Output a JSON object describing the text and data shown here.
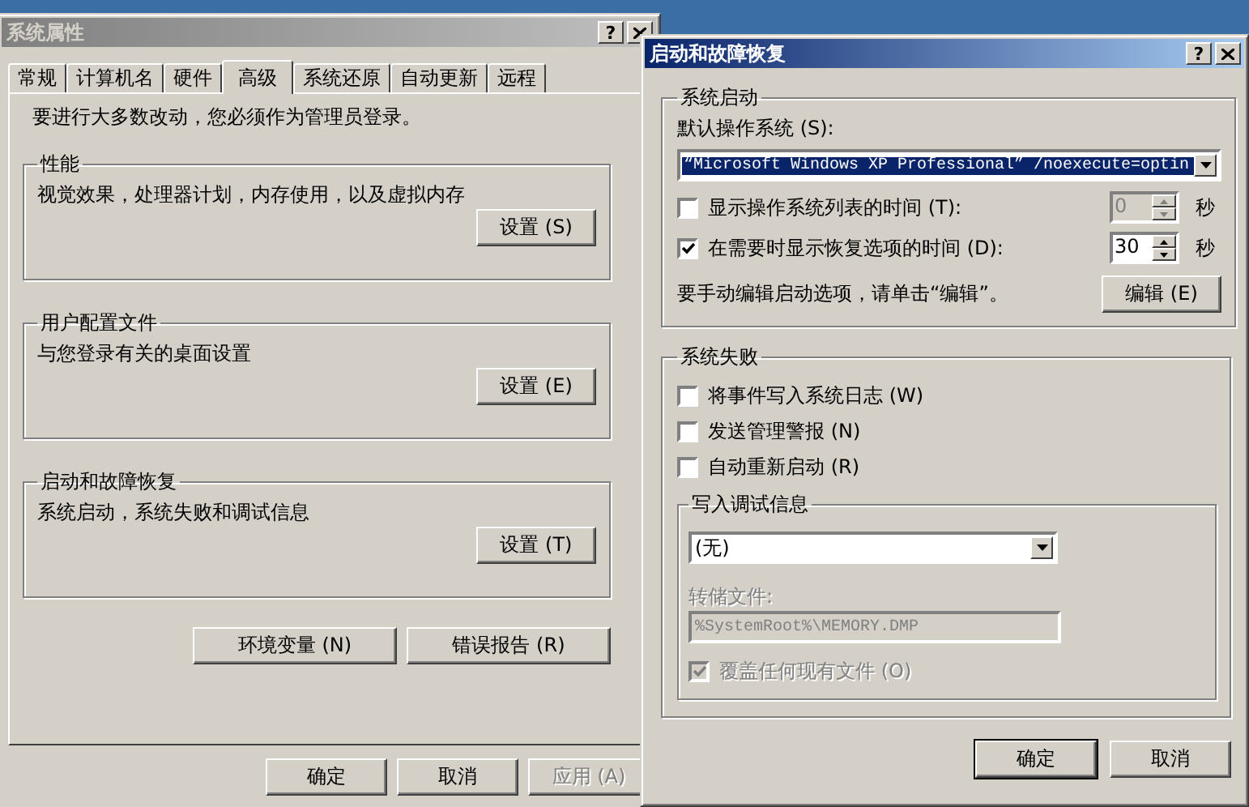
{
  "back_window": {
    "title": "系统属性",
    "help_button": "?",
    "tabs": [
      {
        "label": "常规",
        "selected": false
      },
      {
        "label": "计算机名",
        "selected": false
      },
      {
        "label": "硬件",
        "selected": false
      },
      {
        "label": "高级",
        "selected": true
      },
      {
        "label": "系统还原",
        "selected": false
      },
      {
        "label": "自动更新",
        "selected": false
      },
      {
        "label": "远程",
        "selected": false
      }
    ],
    "notice": "要进行大多数改动，您必须作为管理员登录。",
    "groups": [
      {
        "title": "性能",
        "description": "视觉效果，处理器计划，内存使用，以及虚拟内存",
        "button": "设置 (S)"
      },
      {
        "title": "用户配置文件",
        "description": "与您登录有关的桌面设置",
        "button": "设置 (E)"
      },
      {
        "title": "启动和故障恢复",
        "description": "系统启动，系统失败和调试信息",
        "button": "设置 (T)"
      }
    ],
    "extra_buttons": [
      "环境变量 (N)",
      "错误报告 (R)"
    ],
    "buttons": [
      {
        "label": "确定",
        "disabled": false
      },
      {
        "label": "取消",
        "disabled": false
      },
      {
        "label": "应用 (A)",
        "disabled": true
      }
    ]
  },
  "front_window": {
    "title": "启动和故障恢复",
    "help_button": "?",
    "startup": {
      "title": "系统启动",
      "default_os_label": "默认操作系统 (S):",
      "default_os": "“Microsoft Windows XP Professional” /noexecute=optin",
      "options": [
        {
          "label": "显示操作系统列表的时间 (T):",
          "checked": false,
          "seconds": "0",
          "unit": "秒"
        },
        {
          "label": "在需要时显示恢复选项的时间 (D):",
          "checked": true,
          "seconds": "30",
          "unit": "秒"
        }
      ],
      "edit_hint": "要手动编辑启动选项，请单击“编辑”。",
      "edit_button": "编辑 (E)"
    },
    "failure": {
      "title": "系统失败",
      "options": [
        {
          "label": "将事件写入系统日志 (W)",
          "checked": false
        },
        {
          "label": "发送管理警报 (N)",
          "checked": false
        },
        {
          "label": "自动重新启动 (R)",
          "checked": false
        }
      ],
      "debug": {
        "title": "写入调试信息",
        "type": "(无)",
        "dump_label": "转储文件:",
        "dump_file": "%SystemRoot%\\MEMORY.DMP",
        "overwrite": {
          "label": "覆盖任何现有文件 (O)",
          "checked": true,
          "disabled": true
        }
      }
    },
    "buttons": [
      {
        "label": "确定",
        "default": true
      },
      {
        "label": "取消",
        "default": false
      }
    ]
  }
}
